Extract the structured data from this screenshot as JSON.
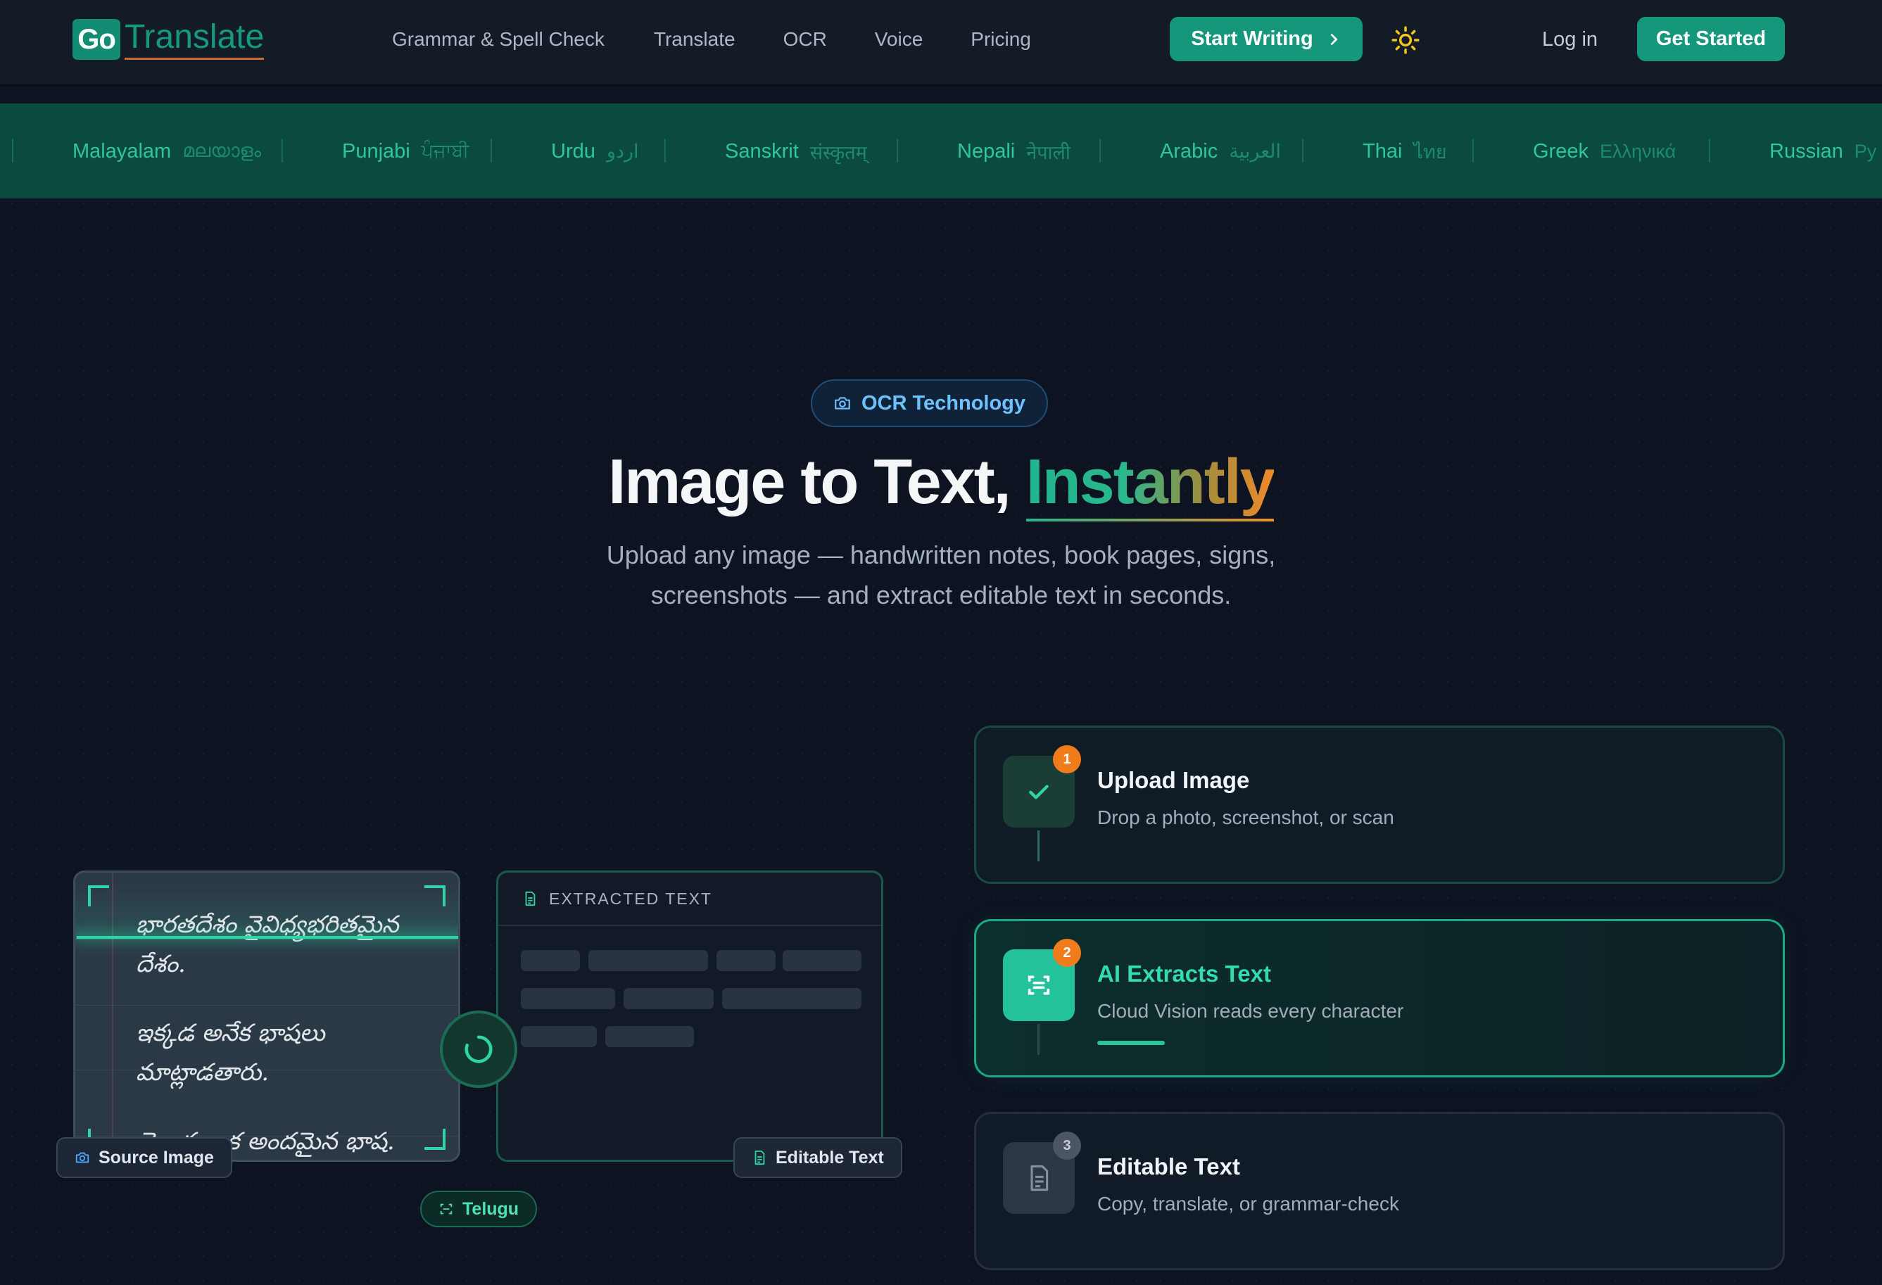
{
  "nav": {
    "logo_go": "Go",
    "logo_translate": "Translate",
    "links": [
      "Grammar & Spell Check",
      "Translate",
      "OCR",
      "Voice",
      "Pricing"
    ],
    "start_writing": "Start Writing",
    "login": "Log in",
    "get_started": "Get Started"
  },
  "ticker": [
    {
      "name": "Malayalam",
      "native": "മലയാളം"
    },
    {
      "name": "Punjabi",
      "native": "ਪੰਜਾਬੀ"
    },
    {
      "name": "Urdu",
      "native": "اردو"
    },
    {
      "name": "Sanskrit",
      "native": "संस्कृतम्"
    },
    {
      "name": "Nepali",
      "native": "नेपाली"
    },
    {
      "name": "Arabic",
      "native": "العربية"
    },
    {
      "name": "Thai",
      "native": "ไทย"
    },
    {
      "name": "Greek",
      "native": "Ελληνικά"
    },
    {
      "name": "Russian",
      "native": "Ру"
    }
  ],
  "hero": {
    "badge": "OCR Technology",
    "title_main": "Image to Text, ",
    "title_accent": "Instantly",
    "subtitle_line1": "Upload any image — handwritten notes, book pages, signs,",
    "subtitle_line2": "screenshots — and extract editable text in seconds."
  },
  "demo": {
    "source_lines": [
      "భారతదేశం వైవిధ్యభరితమైన",
      "దేశం.",
      "ఇక్కడ అనేక భాషలు",
      "మాట్లాడతారు.",
      "తెలుగు ఒక అందమైన భాష."
    ],
    "source_label": "Source Image",
    "extract_header": "EXTRACTED TEXT",
    "editable_label": "Editable Text",
    "language_label": "Telugu"
  },
  "steps": [
    {
      "num": "1",
      "title": "Upload Image",
      "desc": "Drop a photo, screenshot, or scan"
    },
    {
      "num": "2",
      "title": "AI Extracts Text",
      "desc": "Cloud Vision reads every character"
    },
    {
      "num": "3",
      "title": "Editable Text",
      "desc": "Copy, translate, or grammar-check"
    }
  ],
  "colors": {
    "accent": "#14977b",
    "accent_bright": "#23c29b",
    "orange": "#f07c1c",
    "ticker_bg": "#0b4a3e",
    "page_bg": "#0d1320",
    "badge_blue": "#6ec1ff"
  },
  "icons": {
    "theme": "sun-icon",
    "badge": "camera-icon",
    "step1": "check-icon",
    "step2": "scan-icon",
    "step3": "document-icon"
  }
}
